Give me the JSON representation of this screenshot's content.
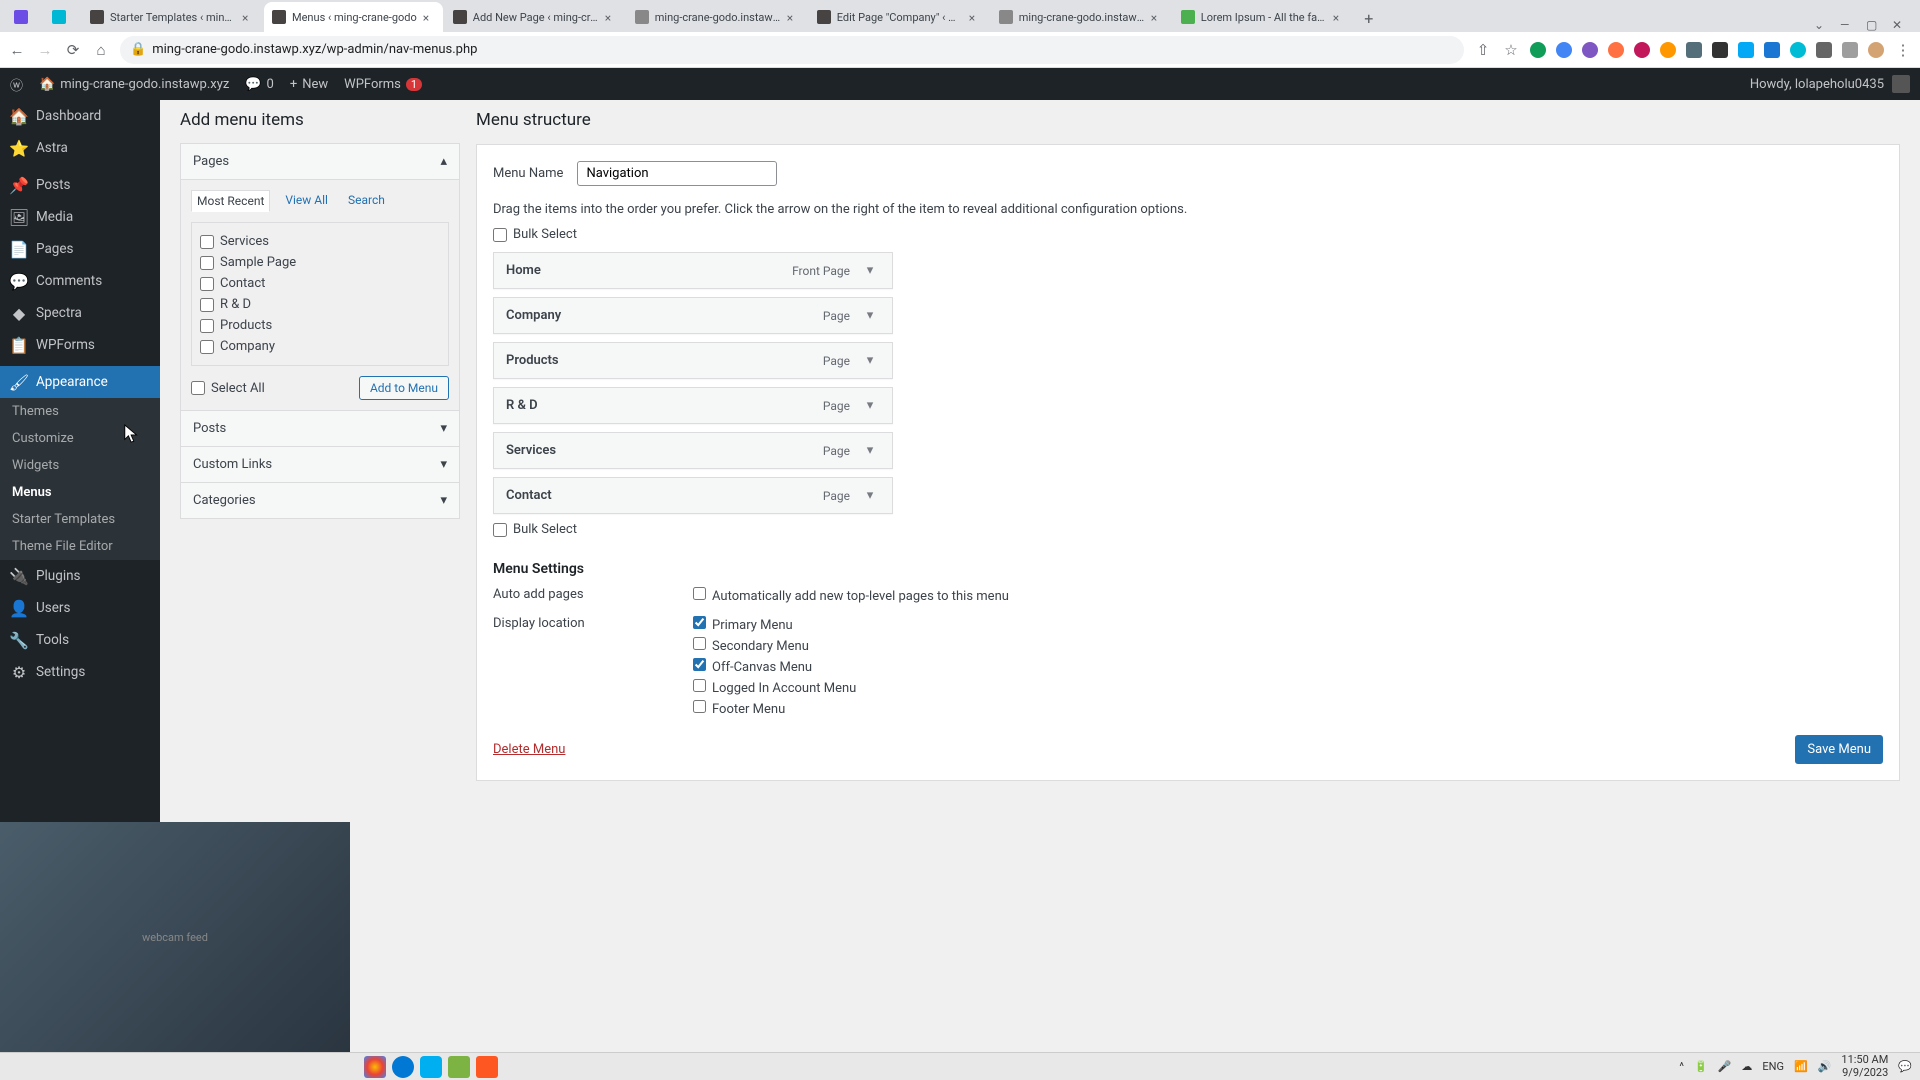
{
  "browser": {
    "tabs": [
      {
        "title": "",
        "color": "#6b4de6"
      },
      {
        "title": "",
        "color": "#00b8d4"
      },
      {
        "title": "Starter Templates ‹ ming-cran",
        "color": "#464342"
      },
      {
        "title": "Menus ‹ ming-crane-godo",
        "color": "#464342",
        "active": true
      },
      {
        "title": "Add New Page ‹ ming-cran",
        "color": "#464342"
      },
      {
        "title": "ming-crane-godo.instawp.xyz",
        "color": "#888"
      },
      {
        "title": "Edit Page \"Company\" ‹ ming",
        "color": "#464342"
      },
      {
        "title": "ming-crane-godo.instawp.xyz",
        "color": "#888"
      },
      {
        "title": "Lorem Ipsum - All the facts -",
        "color": "#4caf50"
      }
    ],
    "url": "ming-crane-godo.instawp.xyz/wp-admin/nav-menus.php"
  },
  "wpbar": {
    "site": "ming-crane-godo.instawp.xyz",
    "comments": "0",
    "new": "New",
    "wpforms": "WPForms",
    "wpforms_badge": "1",
    "howdy": "Howdy, lolapeholu0435"
  },
  "sidebar": {
    "items": [
      {
        "icon": "🏠",
        "label": "Dashboard"
      },
      {
        "icon": "⭐",
        "label": "Astra"
      },
      {
        "icon": "📌",
        "label": "Posts"
      },
      {
        "icon": "🖼",
        "label": "Media"
      },
      {
        "icon": "📄",
        "label": "Pages"
      },
      {
        "icon": "💬",
        "label": "Comments"
      },
      {
        "icon": "◆",
        "label": "Spectra"
      },
      {
        "icon": "📋",
        "label": "WPForms"
      },
      {
        "icon": "🖌",
        "label": "Appearance",
        "active": true
      },
      {
        "icon": "🔌",
        "label": "Plugins"
      },
      {
        "icon": "👤",
        "label": "Users"
      },
      {
        "icon": "🔧",
        "label": "Tools"
      },
      {
        "icon": "⚙",
        "label": "Settings"
      }
    ],
    "subs": [
      {
        "label": "Themes"
      },
      {
        "label": "Customize"
      },
      {
        "label": "Widgets"
      },
      {
        "label": "Menus",
        "active": true
      },
      {
        "label": "Starter Templates"
      },
      {
        "label": "Theme File Editor"
      }
    ]
  },
  "add_items": {
    "heading": "Add menu items",
    "sections": [
      "Pages",
      "Posts",
      "Custom Links",
      "Categories"
    ],
    "tabs": [
      "Most Recent",
      "View All",
      "Search"
    ],
    "pages": [
      "Services",
      "Sample Page",
      "Contact",
      "R & D",
      "Products",
      "Company"
    ],
    "select_all": "Select All",
    "add_btn": "Add to Menu"
  },
  "structure": {
    "heading": "Menu structure",
    "menu_name_label": "Menu Name",
    "menu_name_value": "Navigation",
    "instruction": "Drag the items into the order you prefer. Click the arrow on the right of the item to reveal additional configuration options.",
    "bulk_select": "Bulk Select",
    "items": [
      {
        "title": "Home",
        "type": "Front Page"
      },
      {
        "title": "Company",
        "type": "Page"
      },
      {
        "title": "Products",
        "type": "Page"
      },
      {
        "title": "R & D",
        "type": "Page"
      },
      {
        "title": "Services",
        "type": "Page"
      },
      {
        "title": "Contact",
        "type": "Page"
      }
    ]
  },
  "settings": {
    "heading": "Menu Settings",
    "auto_label": "Auto add pages",
    "auto_opt": "Automatically add new top-level pages to this menu",
    "display_label": "Display location",
    "locations": [
      {
        "label": "Primary Menu",
        "checked": true
      },
      {
        "label": "Secondary Menu",
        "checked": false
      },
      {
        "label": "Off-Canvas Menu",
        "checked": true
      },
      {
        "label": "Logged In Account Menu",
        "checked": false
      },
      {
        "label": "Footer Menu",
        "checked": false
      }
    ],
    "delete": "Delete Menu",
    "save": "Save Menu"
  },
  "taskbar": {
    "lang": "ENG",
    "time": "11:50 AM",
    "date": "9/9/2023"
  }
}
